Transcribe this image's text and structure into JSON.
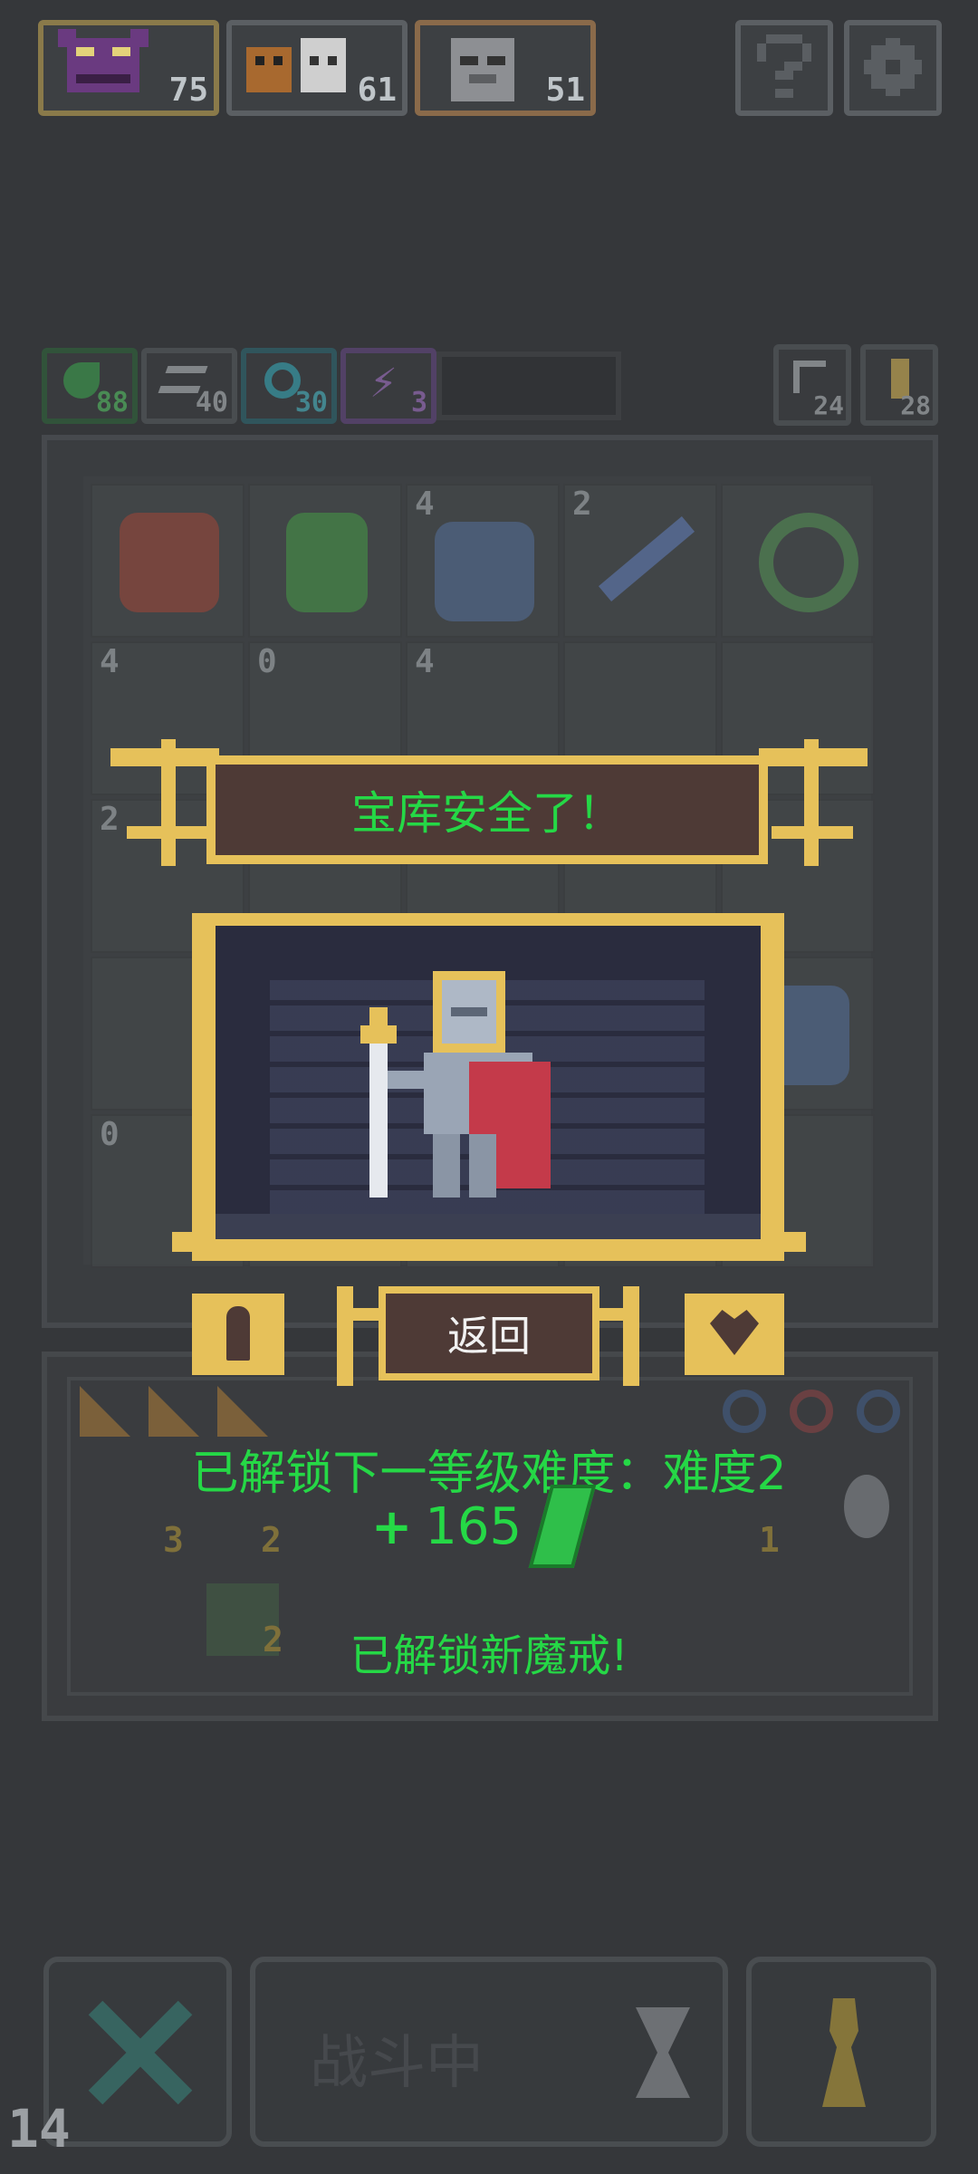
{
  "top_bar": {
    "opponents": [
      {
        "name": "demon",
        "count": "75"
      },
      {
        "name": "beasts",
        "count": "61"
      },
      {
        "name": "ghost",
        "count": "51"
      }
    ],
    "help_icon": "question-icon",
    "settings_icon": "gear-icon"
  },
  "stats_row": {
    "left": [
      {
        "icon": "leaf-icon",
        "value": "88"
      },
      {
        "icon": "wing-icon",
        "value": "40"
      },
      {
        "icon": "spiral-icon",
        "value": "30"
      },
      {
        "icon": "lightning-icon",
        "value": "3"
      }
    ],
    "right": [
      {
        "icon": "return-arrow-icon",
        "value": "24"
      },
      {
        "icon": "key-icon",
        "value": "28"
      }
    ]
  },
  "grid_badges": [
    "4",
    "2",
    "4",
    "0",
    "4",
    "2",
    "0"
  ],
  "dialog": {
    "title": "宝库安全了！",
    "return_label": "返回"
  },
  "rewards": {
    "unlock_difficulty": "已解锁下一等级难度：难度2",
    "gem_plus": "+",
    "gem_amount": "165",
    "unlock_ring": "已解锁新魔戒!",
    "item_counts": [
      "3",
      "2",
      "1",
      "2"
    ]
  },
  "bottom_bar": {
    "status_label": "战斗中",
    "corner_number": "14"
  },
  "colors": {
    "gold": "#e6c15a",
    "banner_brown": "#4e3a36",
    "reward_green": "#25d846",
    "background": "#35373a"
  }
}
